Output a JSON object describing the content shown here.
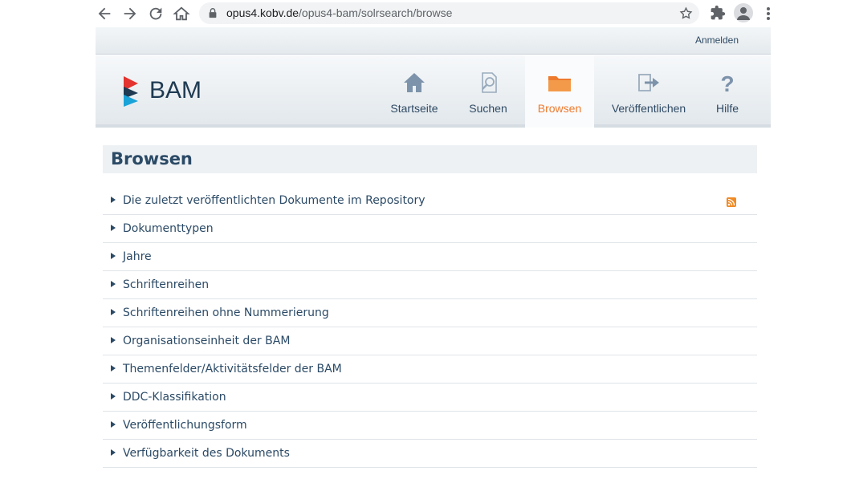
{
  "browser": {
    "url_host": "opus4.kobv.de",
    "url_path": "/opus4-bam/solrsearch/browse"
  },
  "header": {
    "login_label": "Anmelden",
    "logo_text": "BAM"
  },
  "nav": {
    "items": [
      {
        "label": "Startseite",
        "icon": "home-icon"
      },
      {
        "label": "Suchen",
        "icon": "search-document-icon"
      },
      {
        "label": "Browsen",
        "icon": "folder-icon",
        "active": true
      },
      {
        "label": "Veröffentlichen",
        "icon": "publish-icon"
      },
      {
        "label": "Hilfe",
        "icon": "help-icon"
      }
    ]
  },
  "page": {
    "title": "Browsen"
  },
  "browse": {
    "items": [
      {
        "label": "Die zuletzt veröffentlichten Dokumente im Repository"
      },
      {
        "label": "Dokumenttypen"
      },
      {
        "label": "Jahre"
      },
      {
        "label": "Schriftenreihen"
      },
      {
        "label": "Schriftenreihen ohne Nummerierung"
      },
      {
        "label": "Organisationseinheit der BAM"
      },
      {
        "label": "Themenfelder/Aktivitätsfelder der BAM"
      },
      {
        "label": "DDC-Klassifikation"
      },
      {
        "label": "Veröffentlichungsform"
      },
      {
        "label": "Verfügbarkeit des Dokuments"
      }
    ]
  },
  "colors": {
    "accent": "#ee7a2d",
    "text": "#2b4a66",
    "logo_red": "#e3342f",
    "logo_blue": "#1aa3d8"
  }
}
